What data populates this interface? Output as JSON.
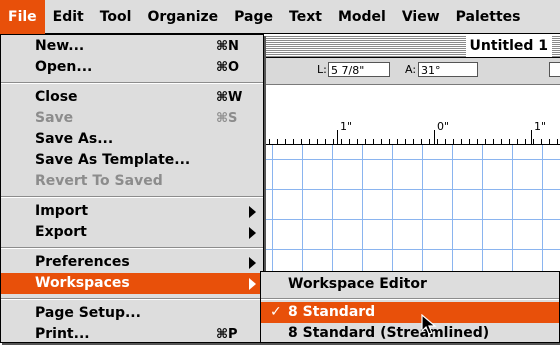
{
  "menubar": {
    "items": [
      {
        "label": "File",
        "active": true
      },
      {
        "label": "Edit"
      },
      {
        "label": "Tool"
      },
      {
        "label": "Organize"
      },
      {
        "label": "Page"
      },
      {
        "label": "Text"
      },
      {
        "label": "Model"
      },
      {
        "label": "View"
      },
      {
        "label": "Palettes"
      }
    ]
  },
  "document": {
    "title": "Untitled 1",
    "fields": {
      "l_label": "L:",
      "l_value": "5 7/8\"",
      "a_label": "A:",
      "a_value": "31°"
    },
    "ruler": [
      "1\"",
      "0\"",
      "1\""
    ]
  },
  "file_menu": {
    "items": [
      {
        "label": "New...",
        "shortcut": "⌘N"
      },
      {
        "label": "Open...",
        "shortcut": "⌘O"
      },
      {
        "label": "Close",
        "shortcut": "⌘W"
      },
      {
        "label": "Save",
        "shortcut": "⌘S",
        "disabled": true
      },
      {
        "label": "Save As..."
      },
      {
        "label": "Save As Template..."
      },
      {
        "label": "Revert To Saved",
        "disabled": true
      },
      {
        "label": "Import",
        "submenu": true
      },
      {
        "label": "Export",
        "submenu": true
      },
      {
        "label": "Preferences",
        "submenu": true
      },
      {
        "label": "Workspaces",
        "submenu": true,
        "selected": true
      },
      {
        "label": "Page Setup..."
      },
      {
        "label": "Print...",
        "shortcut": "⌘P"
      }
    ]
  },
  "workspaces_menu": {
    "items": [
      {
        "label": "Workspace Editor"
      },
      {
        "label": "8 Standard",
        "checked": true,
        "selected": true,
        "check": "✓"
      },
      {
        "label": "8 Standard (Streamlined)"
      }
    ]
  },
  "colors": {
    "highlight": "#e8500a",
    "menu_bg": "#dddddd",
    "grid": "#8ab4ef"
  },
  "icons": {
    "submenu": "triangle-right-icon",
    "check": "checkmark-icon",
    "cursor": "arrow-cursor-icon"
  }
}
